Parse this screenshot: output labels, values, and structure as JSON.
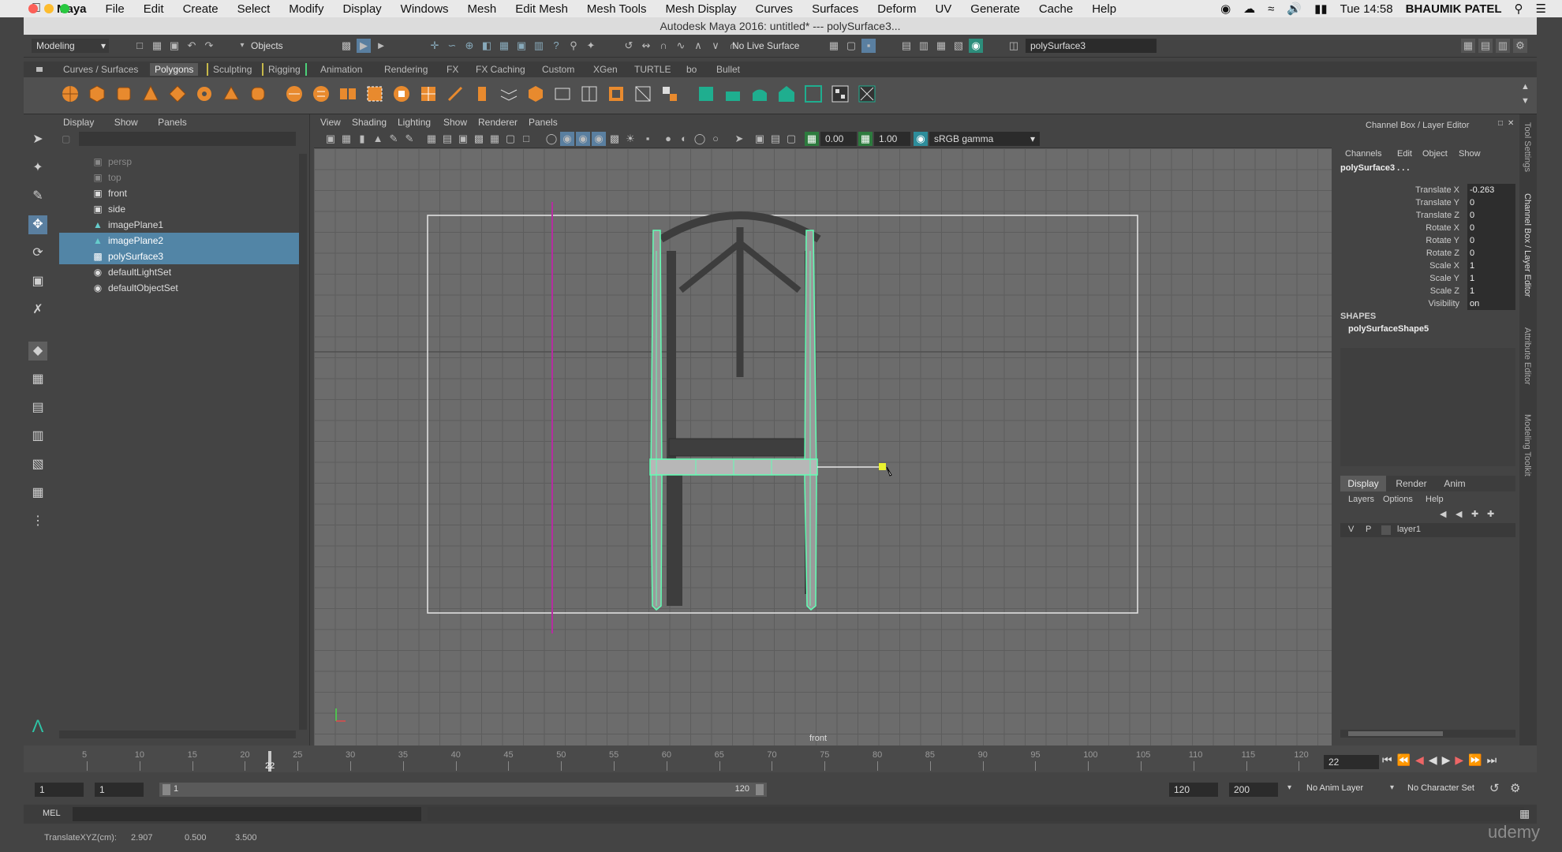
{
  "os_menu": {
    "app_name": "Maya",
    "items": [
      "File",
      "Edit",
      "Create",
      "Select",
      "Modify",
      "Display",
      "Windows",
      "Mesh",
      "Edit Mesh",
      "Mesh Tools",
      "Mesh Display",
      "Curves",
      "Surfaces",
      "Deform",
      "UV",
      "Generate",
      "Cache",
      "Help"
    ],
    "clock": "Tue 14:58",
    "user": "BHAUMIK PATEL"
  },
  "window": {
    "title": "Autodesk Maya 2016: untitled*   ---   polySurface3..."
  },
  "status_line": {
    "menu_set": "Modeling",
    "select_mode": "Objects",
    "live_surface": "No Live Surface",
    "name_field": "polySurface3"
  },
  "shelf": {
    "tabs": [
      "Curves / Surfaces",
      "Polygons",
      "Sculpting",
      "Rigging",
      "Animation",
      "Rendering",
      "FX",
      "FX Caching",
      "Custom",
      "XGen",
      "TURTLE",
      "bo",
      "Bullet"
    ],
    "active_tab": "Polygons"
  },
  "outliner": {
    "menu": [
      "Display",
      "Show",
      "Panels"
    ],
    "items": [
      {
        "label": "persp",
        "icon": "camera-icon",
        "state": "dim"
      },
      {
        "label": "top",
        "icon": "camera-icon",
        "state": "dim"
      },
      {
        "label": "front",
        "icon": "camera-icon",
        "state": "normal"
      },
      {
        "label": "side",
        "icon": "camera-icon",
        "state": "normal"
      },
      {
        "label": "imagePlane1",
        "icon": "image-plane-icon",
        "state": "normal"
      },
      {
        "label": "imagePlane2",
        "icon": "image-plane-icon",
        "state": "selected"
      },
      {
        "label": "polySurface3",
        "icon": "mesh-icon",
        "state": "selected"
      },
      {
        "label": "defaultLightSet",
        "icon": "set-icon",
        "state": "normal"
      },
      {
        "label": "defaultObjectSet",
        "icon": "set-icon",
        "state": "normal"
      }
    ]
  },
  "viewport": {
    "menu": [
      "View",
      "Shading",
      "Lighting",
      "Show",
      "Renderer",
      "Panels"
    ],
    "exposure": "0.00",
    "gamma": "1.00",
    "color_space": "sRGB gamma",
    "camera_label": "front"
  },
  "channel_box": {
    "title": "Channel Box / Layer Editor",
    "menu": [
      "Channels",
      "Edit",
      "Object",
      "Show"
    ],
    "object": "polySurface3 . . .",
    "channels": [
      {
        "name": "Translate X",
        "value": "-0.263"
      },
      {
        "name": "Translate Y",
        "value": "0"
      },
      {
        "name": "Translate Z",
        "value": "0"
      },
      {
        "name": "Rotate X",
        "value": "0"
      },
      {
        "name": "Rotate Y",
        "value": "0"
      },
      {
        "name": "Rotate Z",
        "value": "0"
      },
      {
        "name": "Scale X",
        "value": "1"
      },
      {
        "name": "Scale Y",
        "value": "1"
      },
      {
        "name": "Scale Z",
        "value": "1"
      },
      {
        "name": "Visibility",
        "value": "on"
      }
    ],
    "shapes_label": "SHAPES",
    "shape_name": "polySurfaceShape5",
    "layer_tabs": [
      "Display",
      "Render",
      "Anim"
    ],
    "layer_menu": [
      "Layers",
      "Options",
      "Help"
    ],
    "layer": {
      "v": "V",
      "p": "P",
      "name": "layer1"
    }
  },
  "side_tabs": [
    "Tool Settings",
    "Channel Box / Layer Editor",
    "Attribute Editor",
    "Modeling Toolkit"
  ],
  "timeline": {
    "ticks": [
      "5",
      "10",
      "15",
      "20",
      "25",
      "30",
      "35",
      "40",
      "45",
      "50",
      "55",
      "60",
      "65",
      "70",
      "75",
      "80",
      "85",
      "90",
      "95",
      "100",
      "105",
      "110",
      "115",
      "120"
    ],
    "current_frame": "22",
    "current_frame_field": "22"
  },
  "range": {
    "start": "1",
    "playback_start": "1",
    "slider_start": "1",
    "slider_end": "120",
    "playback_end": "120",
    "end": "200",
    "anim_layer": "No Anim Layer",
    "character_set": "No Character Set"
  },
  "command_line": {
    "label": "MEL"
  },
  "help_line": {
    "label": "TranslateXYZ(cm):",
    "x": "2.907",
    "y": "0.500",
    "z": "3.500"
  },
  "watermark": "udemy"
}
